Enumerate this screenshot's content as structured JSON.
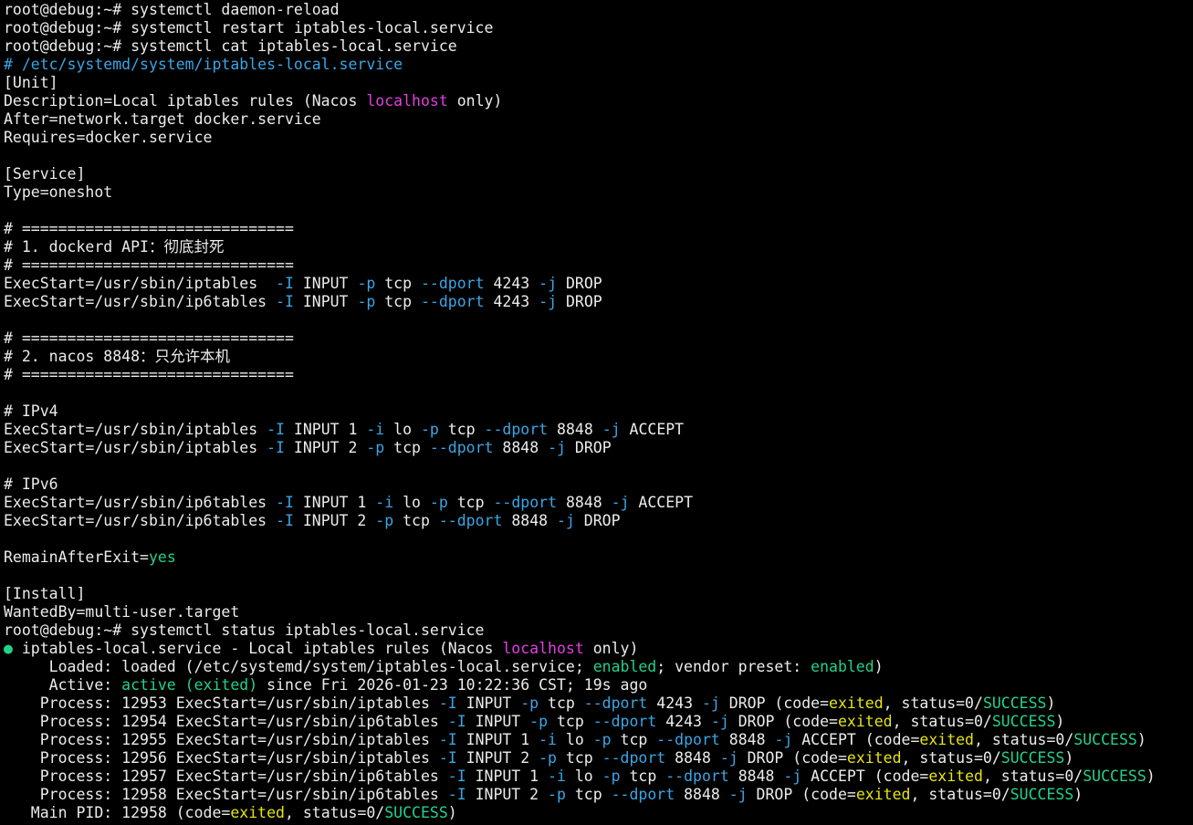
{
  "colors": {
    "background": "#000000",
    "foreground": "#ececec",
    "blue": "#3aa6e6",
    "pink": "#e23fe2",
    "green": "#23d18b",
    "yellow": "#e5e510"
  },
  "terminal": {
    "lines": [
      [
        {
          "t": "root@debug:~# systemctl daemon-reload"
        }
      ],
      [
        {
          "t": "root@debug:~# systemctl restart iptables-local.service"
        }
      ],
      [
        {
          "t": "root@debug:~# systemctl cat iptables-local.service"
        }
      ],
      [
        {
          "t": "# /etc/systemd/system/iptables-local.service",
          "c": "blue"
        }
      ],
      [
        {
          "t": "[Unit]"
        }
      ],
      [
        {
          "t": "Description=Local iptables rules (Nacos "
        },
        {
          "t": "localhost",
          "c": "pink"
        },
        {
          "t": " only)"
        }
      ],
      [
        {
          "t": "After=network.target docker.service"
        }
      ],
      [
        {
          "t": "Requires=docker.service"
        }
      ],
      [
        {
          "t": ""
        }
      ],
      [
        {
          "t": "[Service]"
        }
      ],
      [
        {
          "t": "Type=oneshot"
        }
      ],
      [
        {
          "t": ""
        }
      ],
      [
        {
          "t": "# =============================="
        }
      ],
      [
        {
          "t": "# 1. dockerd API：彻底封死"
        }
      ],
      [
        {
          "t": "# =============================="
        }
      ],
      [
        {
          "t": "ExecStart=/usr/sbin/iptables  "
        },
        {
          "t": "-I",
          "c": "blue"
        },
        {
          "t": " INPUT "
        },
        {
          "t": "-p",
          "c": "blue"
        },
        {
          "t": " tcp "
        },
        {
          "t": "--dport",
          "c": "blue"
        },
        {
          "t": " 4243 "
        },
        {
          "t": "-j",
          "c": "blue"
        },
        {
          "t": " DROP"
        }
      ],
      [
        {
          "t": "ExecStart=/usr/sbin/ip6tables "
        },
        {
          "t": "-I",
          "c": "blue"
        },
        {
          "t": " INPUT "
        },
        {
          "t": "-p",
          "c": "blue"
        },
        {
          "t": " tcp "
        },
        {
          "t": "--dport",
          "c": "blue"
        },
        {
          "t": " 4243 "
        },
        {
          "t": "-j",
          "c": "blue"
        },
        {
          "t": " DROP"
        }
      ],
      [
        {
          "t": ""
        }
      ],
      [
        {
          "t": "# =============================="
        }
      ],
      [
        {
          "t": "# 2. nacos 8848：只允许本机"
        }
      ],
      [
        {
          "t": "# =============================="
        }
      ],
      [
        {
          "t": ""
        }
      ],
      [
        {
          "t": "# IPv4"
        }
      ],
      [
        {
          "t": "ExecStart=/usr/sbin/iptables "
        },
        {
          "t": "-I",
          "c": "blue"
        },
        {
          "t": " INPUT 1 "
        },
        {
          "t": "-i",
          "c": "blue"
        },
        {
          "t": " lo "
        },
        {
          "t": "-p",
          "c": "blue"
        },
        {
          "t": " tcp "
        },
        {
          "t": "--dport",
          "c": "blue"
        },
        {
          "t": " 8848 "
        },
        {
          "t": "-j",
          "c": "blue"
        },
        {
          "t": " ACCEPT"
        }
      ],
      [
        {
          "t": "ExecStart=/usr/sbin/iptables "
        },
        {
          "t": "-I",
          "c": "blue"
        },
        {
          "t": " INPUT 2 "
        },
        {
          "t": "-p",
          "c": "blue"
        },
        {
          "t": " tcp "
        },
        {
          "t": "--dport",
          "c": "blue"
        },
        {
          "t": " 8848 "
        },
        {
          "t": "-j",
          "c": "blue"
        },
        {
          "t": " DROP"
        }
      ],
      [
        {
          "t": ""
        }
      ],
      [
        {
          "t": "# IPv6"
        }
      ],
      [
        {
          "t": "ExecStart=/usr/sbin/ip6tables "
        },
        {
          "t": "-I",
          "c": "blue"
        },
        {
          "t": " INPUT 1 "
        },
        {
          "t": "-i",
          "c": "blue"
        },
        {
          "t": " lo "
        },
        {
          "t": "-p",
          "c": "blue"
        },
        {
          "t": " tcp "
        },
        {
          "t": "--dport",
          "c": "blue"
        },
        {
          "t": " 8848 "
        },
        {
          "t": "-j",
          "c": "blue"
        },
        {
          "t": " ACCEPT"
        }
      ],
      [
        {
          "t": "ExecStart=/usr/sbin/ip6tables "
        },
        {
          "t": "-I",
          "c": "blue"
        },
        {
          "t": " INPUT 2 "
        },
        {
          "t": "-p",
          "c": "blue"
        },
        {
          "t": " tcp "
        },
        {
          "t": "--dport",
          "c": "blue"
        },
        {
          "t": " 8848 "
        },
        {
          "t": "-j",
          "c": "blue"
        },
        {
          "t": " DROP"
        }
      ],
      [
        {
          "t": ""
        }
      ],
      [
        {
          "t": "RemainAfterExit="
        },
        {
          "t": "yes",
          "c": "green"
        }
      ],
      [
        {
          "t": ""
        }
      ],
      [
        {
          "t": "[Install]"
        }
      ],
      [
        {
          "t": "WantedBy=multi-user.target"
        }
      ],
      [
        {
          "t": "root@debug:~# systemctl status iptables-local.service"
        }
      ],
      [
        {
          "t": "●",
          "c": "dot"
        },
        {
          "t": " iptables-local.service - Local iptables rules (Nacos "
        },
        {
          "t": "localhost",
          "c": "pink"
        },
        {
          "t": " only)"
        }
      ],
      [
        {
          "t": "     Loaded: loaded (/etc/systemd/system/iptables-local.service; "
        },
        {
          "t": "enabled",
          "c": "green"
        },
        {
          "t": "; vendor preset: "
        },
        {
          "t": "enabled",
          "c": "green"
        },
        {
          "t": ")"
        }
      ],
      [
        {
          "t": "     Active: "
        },
        {
          "t": "active (exited)",
          "c": "green"
        },
        {
          "t": " since Fri 2026-01-23 10:22:36 CST; 19s ago"
        }
      ],
      [
        {
          "t": "    Process: 12953 ExecStart=/usr/sbin/iptables "
        },
        {
          "t": "-I",
          "c": "blue"
        },
        {
          "t": " INPUT "
        },
        {
          "t": "-p",
          "c": "blue"
        },
        {
          "t": " tcp "
        },
        {
          "t": "--dport",
          "c": "blue"
        },
        {
          "t": " 4243 "
        },
        {
          "t": "-j",
          "c": "blue"
        },
        {
          "t": " DROP (code="
        },
        {
          "t": "exited",
          "c": "yellow"
        },
        {
          "t": ", status=0/"
        },
        {
          "t": "SUCCESS",
          "c": "green"
        },
        {
          "t": ")"
        }
      ],
      [
        {
          "t": "    Process: 12954 ExecStart=/usr/sbin/ip6tables "
        },
        {
          "t": "-I",
          "c": "blue"
        },
        {
          "t": " INPUT "
        },
        {
          "t": "-p",
          "c": "blue"
        },
        {
          "t": " tcp "
        },
        {
          "t": "--dport",
          "c": "blue"
        },
        {
          "t": " 4243 "
        },
        {
          "t": "-j",
          "c": "blue"
        },
        {
          "t": " DROP (code="
        },
        {
          "t": "exited",
          "c": "yellow"
        },
        {
          "t": ", status=0/"
        },
        {
          "t": "SUCCESS",
          "c": "green"
        },
        {
          "t": ")"
        }
      ],
      [
        {
          "t": "    Process: 12955 ExecStart=/usr/sbin/iptables "
        },
        {
          "t": "-I",
          "c": "blue"
        },
        {
          "t": " INPUT 1 "
        },
        {
          "t": "-i",
          "c": "blue"
        },
        {
          "t": " lo "
        },
        {
          "t": "-p",
          "c": "blue"
        },
        {
          "t": " tcp "
        },
        {
          "t": "--dport",
          "c": "blue"
        },
        {
          "t": " 8848 "
        },
        {
          "t": "-j",
          "c": "blue"
        },
        {
          "t": " ACCEPT (code="
        },
        {
          "t": "exited",
          "c": "yellow"
        },
        {
          "t": ", status=0/"
        },
        {
          "t": "SUCCESS",
          "c": "green"
        },
        {
          "t": ")"
        }
      ],
      [
        {
          "t": "    Process: 12956 ExecStart=/usr/sbin/iptables "
        },
        {
          "t": "-I",
          "c": "blue"
        },
        {
          "t": " INPUT 2 "
        },
        {
          "t": "-p",
          "c": "blue"
        },
        {
          "t": " tcp "
        },
        {
          "t": "--dport",
          "c": "blue"
        },
        {
          "t": " 8848 "
        },
        {
          "t": "-j",
          "c": "blue"
        },
        {
          "t": " DROP (code="
        },
        {
          "t": "exited",
          "c": "yellow"
        },
        {
          "t": ", status=0/"
        },
        {
          "t": "SUCCESS",
          "c": "green"
        },
        {
          "t": ")"
        }
      ],
      [
        {
          "t": "    Process: 12957 ExecStart=/usr/sbin/ip6tables "
        },
        {
          "t": "-I",
          "c": "blue"
        },
        {
          "t": " INPUT 1 "
        },
        {
          "t": "-i",
          "c": "blue"
        },
        {
          "t": " lo "
        },
        {
          "t": "-p",
          "c": "blue"
        },
        {
          "t": " tcp "
        },
        {
          "t": "--dport",
          "c": "blue"
        },
        {
          "t": " 8848 "
        },
        {
          "t": "-j",
          "c": "blue"
        },
        {
          "t": " ACCEPT (code="
        },
        {
          "t": "exited",
          "c": "yellow"
        },
        {
          "t": ", status=0/"
        },
        {
          "t": "SUCCESS",
          "c": "green"
        },
        {
          "t": ")"
        }
      ],
      [
        {
          "t": "    Process: 12958 ExecStart=/usr/sbin/ip6tables "
        },
        {
          "t": "-I",
          "c": "blue"
        },
        {
          "t": " INPUT 2 "
        },
        {
          "t": "-p",
          "c": "blue"
        },
        {
          "t": " tcp "
        },
        {
          "t": "--dport",
          "c": "blue"
        },
        {
          "t": " 8848 "
        },
        {
          "t": "-j",
          "c": "blue"
        },
        {
          "t": " DROP (code="
        },
        {
          "t": "exited",
          "c": "yellow"
        },
        {
          "t": ", status=0/"
        },
        {
          "t": "SUCCESS",
          "c": "green"
        },
        {
          "t": ")"
        }
      ],
      [
        {
          "t": "   Main PID: 12958 (code="
        },
        {
          "t": "exited",
          "c": "yellow"
        },
        {
          "t": ", status=0/"
        },
        {
          "t": "SUCCESS",
          "c": "green"
        },
        {
          "t": ")"
        }
      ]
    ]
  }
}
